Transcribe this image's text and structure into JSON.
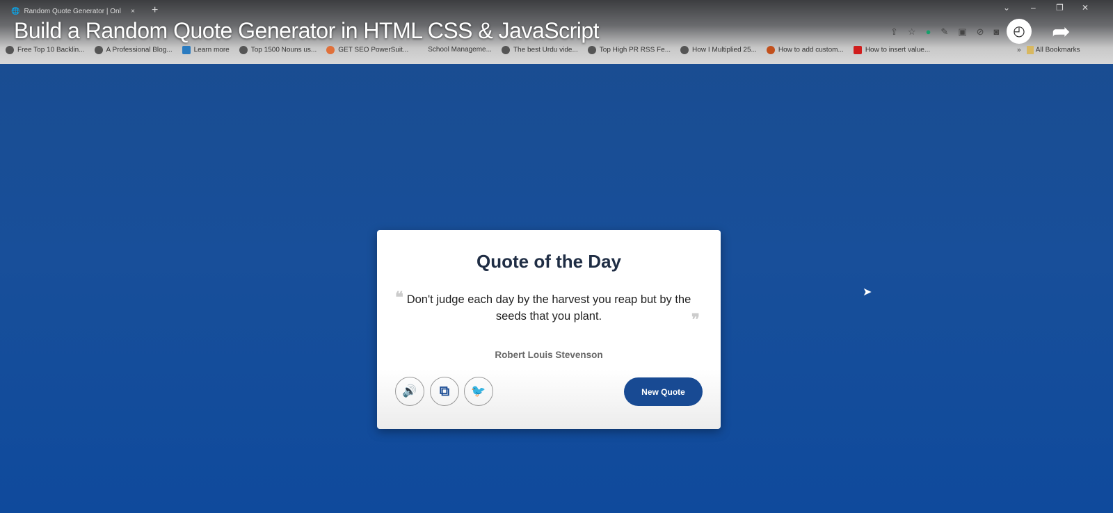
{
  "browser": {
    "tab_title": "Random Quote Generator | Onl",
    "new_tab": "+",
    "close": "×",
    "window_controls": [
      "⌄",
      "–",
      "❐",
      "✕"
    ],
    "bookmarks": [
      "Free Top 10 Backlin...",
      "A Professional Blog...",
      "Learn more",
      "Top 1500 Nouns us...",
      "GET SEO PowerSuit...",
      "School Manageme...",
      "The best Urdu vide...",
      "Top High PR RSS Fe...",
      "How I Multiplied 25...",
      "How to add custom...",
      "How to insert value..."
    ],
    "more_bookmarks": "»",
    "all_bookmarks": "All Bookmarks"
  },
  "video": {
    "title": "Build a Random Quote Generator in HTML CSS & JavaScript",
    "watch_later_icon": "clock-icon",
    "share_icon": "share-arrow-icon"
  },
  "card": {
    "title": "Quote of the Day",
    "quote": "Don't judge each day by the harvest you reap but by the seeds that you plant.",
    "open_mark": "❝",
    "close_mark": "❞",
    "author": "Robert Louis Stevenson",
    "new_quote": "New Quote",
    "icons": {
      "speak": "🔊",
      "copy": "⧉",
      "twitter": "🐦"
    }
  },
  "colors": {
    "accent": "#184a93",
    "background": "#184f9a"
  }
}
